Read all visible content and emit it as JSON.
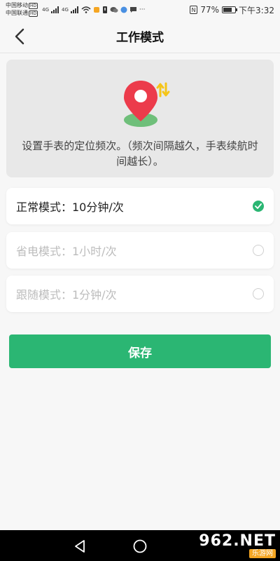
{
  "status_bar": {
    "carrier_1": "中国移动",
    "carrier_2": "中国联通",
    "hd_badge": "HD",
    "network_1": "4G",
    "network_2": "4G",
    "battery_percent": "77%",
    "battery_level": 0.77,
    "time": "下午3:32",
    "icons": [
      "signal-icon",
      "wifi-icon",
      "notification-icon",
      "wechat-icon",
      "chat-icon",
      "nfc-icon",
      "battery-icon"
    ]
  },
  "header": {
    "title": "工作模式",
    "back_icon": "chevron-left-icon"
  },
  "banner": {
    "icon": "location-pin-icon",
    "badge_icon": "sort-arrows-icon",
    "text": "设置手表的定位频次。（频次间隔越久，手表续航时间越长）。"
  },
  "modes": [
    {
      "label": "正常模式：10分钟/次",
      "selected": true
    },
    {
      "label": "省电模式：1小时/次",
      "selected": false
    },
    {
      "label": "跟随模式：1分钟/次",
      "selected": false
    }
  ],
  "actions": {
    "save_label": "保存"
  },
  "system_nav": {
    "back": "triangle-back-icon",
    "home": "circle-home-icon"
  },
  "watermark": {
    "main": "962.NET",
    "sub": "乐游网"
  },
  "colors": {
    "accent": "#2bb673",
    "banner_bg": "#e8e8e8",
    "pin_red": "#ec3b4b",
    "badge_yellow": "#f5c518",
    "page_bg": "#f7f7f7"
  }
}
